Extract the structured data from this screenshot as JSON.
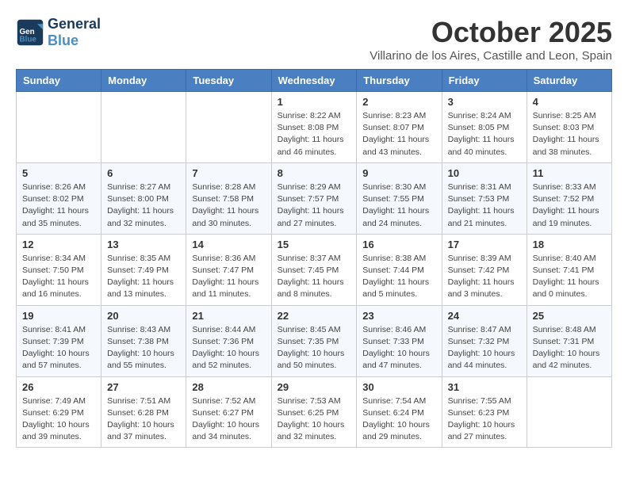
{
  "header": {
    "logo_general": "General",
    "logo_blue": "Blue",
    "month_title": "October 2025",
    "subtitle": "Villarino de los Aires, Castille and Leon, Spain"
  },
  "days_of_week": [
    "Sunday",
    "Monday",
    "Tuesday",
    "Wednesday",
    "Thursday",
    "Friday",
    "Saturday"
  ],
  "weeks": [
    [
      {
        "day": "",
        "info": ""
      },
      {
        "day": "",
        "info": ""
      },
      {
        "day": "",
        "info": ""
      },
      {
        "day": "1",
        "info": "Sunrise: 8:22 AM\nSunset: 8:08 PM\nDaylight: 11 hours and 46 minutes."
      },
      {
        "day": "2",
        "info": "Sunrise: 8:23 AM\nSunset: 8:07 PM\nDaylight: 11 hours and 43 minutes."
      },
      {
        "day": "3",
        "info": "Sunrise: 8:24 AM\nSunset: 8:05 PM\nDaylight: 11 hours and 40 minutes."
      },
      {
        "day": "4",
        "info": "Sunrise: 8:25 AM\nSunset: 8:03 PM\nDaylight: 11 hours and 38 minutes."
      }
    ],
    [
      {
        "day": "5",
        "info": "Sunrise: 8:26 AM\nSunset: 8:02 PM\nDaylight: 11 hours and 35 minutes."
      },
      {
        "day": "6",
        "info": "Sunrise: 8:27 AM\nSunset: 8:00 PM\nDaylight: 11 hours and 32 minutes."
      },
      {
        "day": "7",
        "info": "Sunrise: 8:28 AM\nSunset: 7:58 PM\nDaylight: 11 hours and 30 minutes."
      },
      {
        "day": "8",
        "info": "Sunrise: 8:29 AM\nSunset: 7:57 PM\nDaylight: 11 hours and 27 minutes."
      },
      {
        "day": "9",
        "info": "Sunrise: 8:30 AM\nSunset: 7:55 PM\nDaylight: 11 hours and 24 minutes."
      },
      {
        "day": "10",
        "info": "Sunrise: 8:31 AM\nSunset: 7:53 PM\nDaylight: 11 hours and 21 minutes."
      },
      {
        "day": "11",
        "info": "Sunrise: 8:33 AM\nSunset: 7:52 PM\nDaylight: 11 hours and 19 minutes."
      }
    ],
    [
      {
        "day": "12",
        "info": "Sunrise: 8:34 AM\nSunset: 7:50 PM\nDaylight: 11 hours and 16 minutes."
      },
      {
        "day": "13",
        "info": "Sunrise: 8:35 AM\nSunset: 7:49 PM\nDaylight: 11 hours and 13 minutes."
      },
      {
        "day": "14",
        "info": "Sunrise: 8:36 AM\nSunset: 7:47 PM\nDaylight: 11 hours and 11 minutes."
      },
      {
        "day": "15",
        "info": "Sunrise: 8:37 AM\nSunset: 7:45 PM\nDaylight: 11 hours and 8 minutes."
      },
      {
        "day": "16",
        "info": "Sunrise: 8:38 AM\nSunset: 7:44 PM\nDaylight: 11 hours and 5 minutes."
      },
      {
        "day": "17",
        "info": "Sunrise: 8:39 AM\nSunset: 7:42 PM\nDaylight: 11 hours and 3 minutes."
      },
      {
        "day": "18",
        "info": "Sunrise: 8:40 AM\nSunset: 7:41 PM\nDaylight: 11 hours and 0 minutes."
      }
    ],
    [
      {
        "day": "19",
        "info": "Sunrise: 8:41 AM\nSunset: 7:39 PM\nDaylight: 10 hours and 57 minutes."
      },
      {
        "day": "20",
        "info": "Sunrise: 8:43 AM\nSunset: 7:38 PM\nDaylight: 10 hours and 55 minutes."
      },
      {
        "day": "21",
        "info": "Sunrise: 8:44 AM\nSunset: 7:36 PM\nDaylight: 10 hours and 52 minutes."
      },
      {
        "day": "22",
        "info": "Sunrise: 8:45 AM\nSunset: 7:35 PM\nDaylight: 10 hours and 50 minutes."
      },
      {
        "day": "23",
        "info": "Sunrise: 8:46 AM\nSunset: 7:33 PM\nDaylight: 10 hours and 47 minutes."
      },
      {
        "day": "24",
        "info": "Sunrise: 8:47 AM\nSunset: 7:32 PM\nDaylight: 10 hours and 44 minutes."
      },
      {
        "day": "25",
        "info": "Sunrise: 8:48 AM\nSunset: 7:31 PM\nDaylight: 10 hours and 42 minutes."
      }
    ],
    [
      {
        "day": "26",
        "info": "Sunrise: 7:49 AM\nSunset: 6:29 PM\nDaylight: 10 hours and 39 minutes."
      },
      {
        "day": "27",
        "info": "Sunrise: 7:51 AM\nSunset: 6:28 PM\nDaylight: 10 hours and 37 minutes."
      },
      {
        "day": "28",
        "info": "Sunrise: 7:52 AM\nSunset: 6:27 PM\nDaylight: 10 hours and 34 minutes."
      },
      {
        "day": "29",
        "info": "Sunrise: 7:53 AM\nSunset: 6:25 PM\nDaylight: 10 hours and 32 minutes."
      },
      {
        "day": "30",
        "info": "Sunrise: 7:54 AM\nSunset: 6:24 PM\nDaylight: 10 hours and 29 minutes."
      },
      {
        "day": "31",
        "info": "Sunrise: 7:55 AM\nSunset: 6:23 PM\nDaylight: 10 hours and 27 minutes."
      },
      {
        "day": "",
        "info": ""
      }
    ]
  ]
}
